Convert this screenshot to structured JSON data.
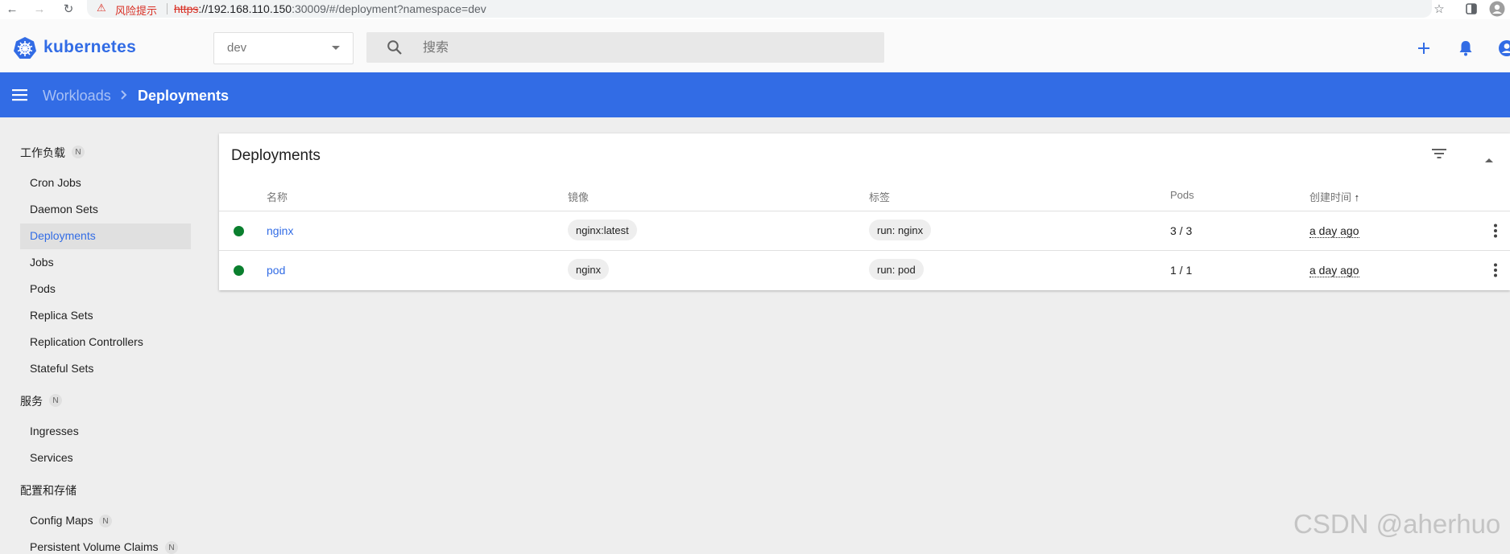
{
  "browser": {
    "warning_label": "风险提示",
    "url_scheme": "https",
    "url_host": "://192.168.110.150",
    "url_rest": ":30009/#/deployment?namespace=dev"
  },
  "header": {
    "brand": "kubernetes",
    "namespace": "dev",
    "search_placeholder": "搜索"
  },
  "toolbar": {
    "breadcrumb_parent": "Workloads",
    "breadcrumb_current": "Deployments"
  },
  "sidebar": {
    "workloads_label": "工作负载",
    "workloads_badge": "N",
    "workloads_items": [
      "Cron Jobs",
      "Daemon Sets",
      "Deployments",
      "Jobs",
      "Pods",
      "Replica Sets",
      "Replication Controllers",
      "Stateful Sets"
    ],
    "services_label": "服务",
    "services_badge": "N",
    "services_items": [
      "Ingresses",
      "Services"
    ],
    "config_label": "配置和存储",
    "config_items": [
      "Config Maps",
      "Persistent Volume Claims"
    ],
    "config_badge": "N"
  },
  "deployments": {
    "title": "Deployments",
    "columns": [
      "名称",
      "镜像",
      "标签",
      "Pods",
      "创建时间"
    ],
    "sort_indicator": "↑",
    "rows": [
      {
        "name": "nginx",
        "image": "nginx:latest",
        "label": "run: nginx",
        "pods": "3 / 3",
        "created": "a day ago"
      },
      {
        "name": "pod",
        "image": "nginx",
        "label": "run: pod",
        "pods": "1 / 1",
        "created": "a day ago"
      }
    ]
  },
  "watermark": "CSDN @aherhuo",
  "colors": {
    "brand_blue": "#326ce5",
    "status_green": "#0a7f2e",
    "warning_red": "#d93025"
  }
}
